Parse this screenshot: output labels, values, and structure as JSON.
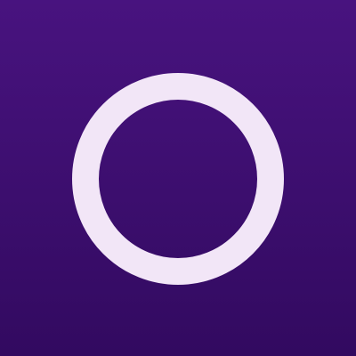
{
  "icon": {
    "name": "ring-icon",
    "background_top_color": "#48137f",
    "background_bottom_color": "#320a60",
    "ring_color": "#f2e6f7"
  }
}
